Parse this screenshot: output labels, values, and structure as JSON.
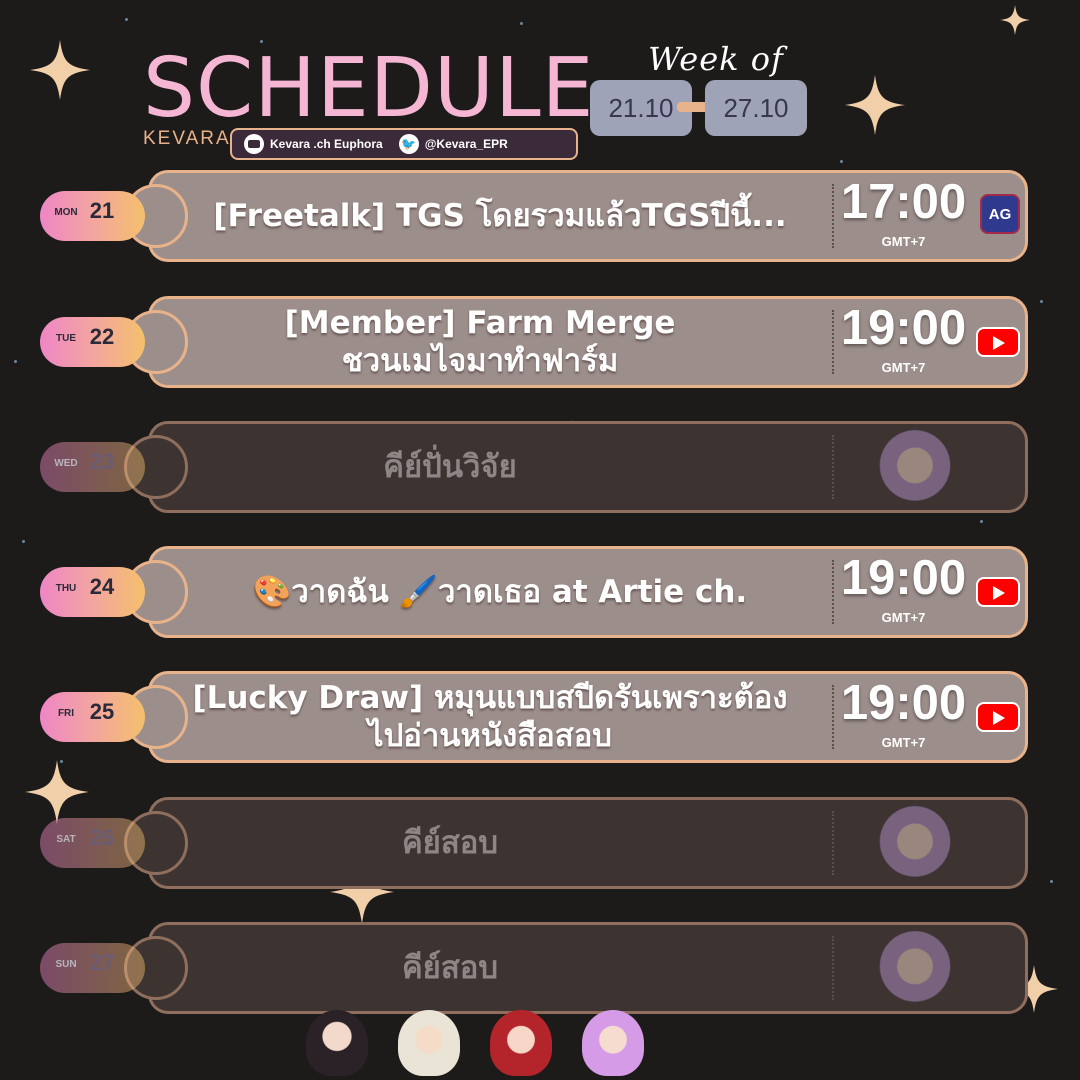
{
  "header": {
    "title": "SCHEDULE",
    "brand": "KEVARA",
    "week_label": "Week of",
    "week_start": "21.10",
    "week_end": "27.10",
    "socials": [
      {
        "icon": "youtube-icon",
        "label": "Kevara .ch Euphora"
      },
      {
        "icon": "twitter-icon",
        "label": "@Kevara_EPR"
      }
    ]
  },
  "days": [
    {
      "day": "MON",
      "date": "21",
      "title_lines": [
        "[Freetalk] TGS โดยรวมแล้วTGSปีนี้..."
      ],
      "time": "17:00",
      "tz": "GMT+7",
      "platform": "ag-game-icon",
      "platform_label": "AG",
      "active": true
    },
    {
      "day": "TUE",
      "date": "22",
      "title_lines": [
        "[Member] Farm Merge",
        "ชวนเมไจมาทำฟาร์ม"
      ],
      "time": "19:00",
      "tz": "GMT+7",
      "platform": "youtube-icon",
      "active": true
    },
    {
      "day": "WED",
      "date": "23",
      "title_lines": [
        "คีย์ปั่นวิจัย"
      ],
      "active": false
    },
    {
      "day": "THU",
      "date": "24",
      "title_lines": [
        "🎨วาดฉัน 🖌️วาดเธอ at Artie ch."
      ],
      "time": "19:00",
      "tz": "GMT+7",
      "platform": "youtube-icon",
      "active": true
    },
    {
      "day": "FRI",
      "date": "25",
      "title_lines": [
        "[Lucky Draw] หมุนแบบสปีดรันเพราะต้อง",
        "ไปอ่านหนังสือสอบ"
      ],
      "time": "19:00",
      "tz": "GMT+7",
      "platform": "youtube-icon",
      "active": true
    },
    {
      "day": "SAT",
      "date": "26",
      "title_lines": [
        "คีย์สอบ"
      ],
      "active": false
    },
    {
      "day": "SUN",
      "date": "27",
      "title_lines": [
        "คีย์สอบ"
      ],
      "active": false
    }
  ],
  "colors": {
    "background": "#1d1a1a",
    "title_pink": "#f4b6d3",
    "accent_peach": "#e8b28b",
    "row_active": "#9c8e8b",
    "row_inactive": "#3d3432",
    "date_box": "#9fa3b8",
    "youtube_red": "#ff0000"
  }
}
